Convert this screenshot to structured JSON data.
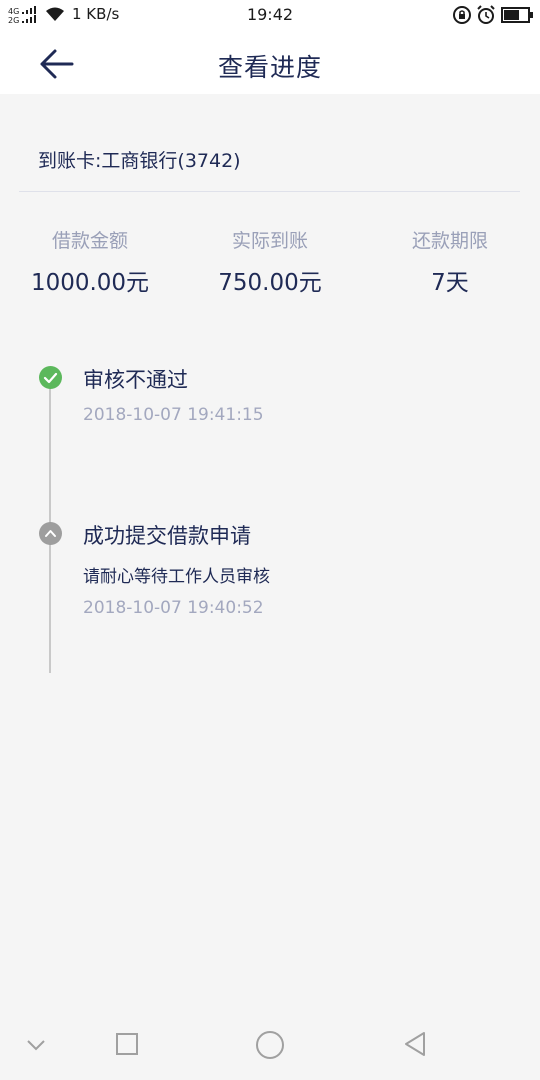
{
  "status_bar": {
    "network": "4G 2G",
    "speed": "1 KB/s",
    "time": "19:42"
  },
  "header": {
    "title": "查看进度"
  },
  "card": {
    "label": "到账卡:工商银行(3742)"
  },
  "stats": [
    {
      "label": "借款金额",
      "value": "1000.00元"
    },
    {
      "label": "实际到账",
      "value": "750.00元"
    },
    {
      "label": "还款期限",
      "value": "7天"
    }
  ],
  "timeline": [
    {
      "title": "审核不通过",
      "time": "2018-10-07 19:41:15",
      "status_color": "#5cb85c",
      "icon": "check-icon"
    },
    {
      "title": "成功提交借款申请",
      "desc": "请耐心等待工作人员审核",
      "time": "2018-10-07 19:40:52",
      "status_color": "#9e9e9e",
      "icon": "chevron-up-icon"
    }
  ],
  "colors": {
    "primary_text": "#1f2a55",
    "muted_text": "#9aa0b8",
    "background": "#f5f5f5"
  }
}
